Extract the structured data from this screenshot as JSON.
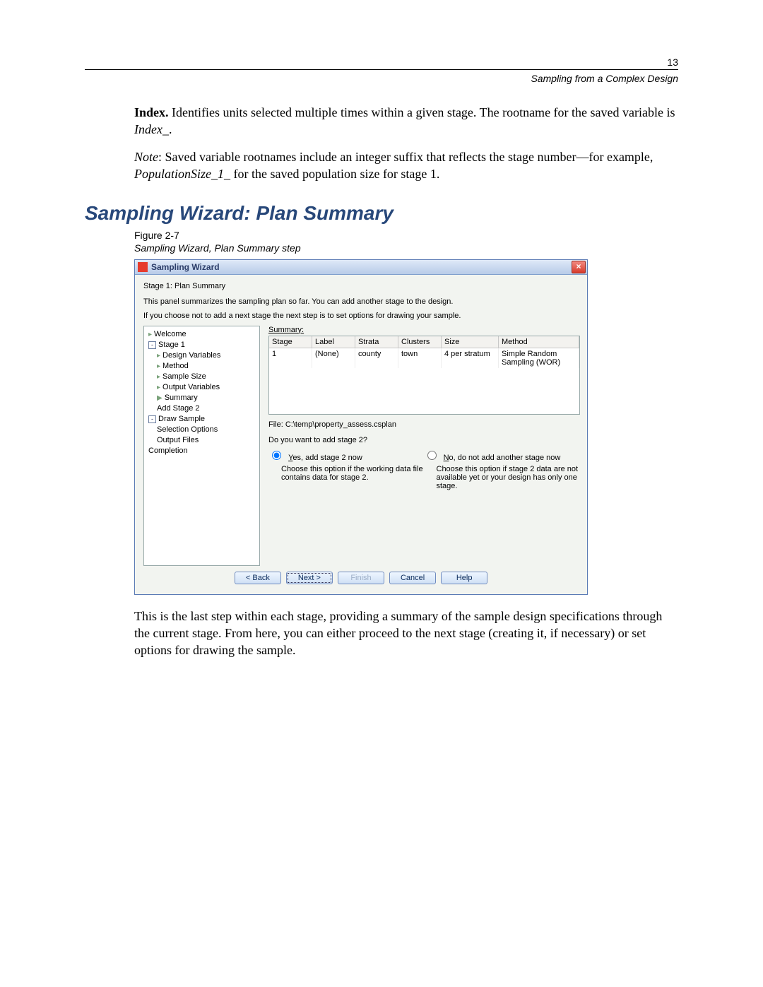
{
  "page": {
    "number": "13"
  },
  "running_head": "Sampling from a Complex Design",
  "para_index": {
    "lead": "Index.",
    "rest": " Identifies units selected multiple times within a given stage. The rootname for the saved variable is ",
    "ital": "Index_",
    "tail": "."
  },
  "para_note": {
    "lead": "Note",
    "mid": ": Saved variable rootnames include an integer suffix that reflects the stage number—for example, ",
    "ital": "PopulationSize_1_",
    "tail": " for the saved population size for stage 1."
  },
  "heading": "Sampling Wizard: Plan Summary",
  "figure": {
    "label": "Figure 2-7",
    "title": "Sampling Wizard, Plan Summary step"
  },
  "wizard": {
    "title": "Sampling Wizard",
    "stage_title": "Stage 1: Plan Summary",
    "line1": "This panel summarizes the sampling plan so far. You can add another stage to the design.",
    "line2": "If you choose not to add a next stage the next step is to set options for drawing your sample.",
    "tree": {
      "welcome": "Welcome",
      "stage1": "Stage 1",
      "design_vars": "Design Variables",
      "method": "Method",
      "sample_size": "Sample Size",
      "output_vars": "Output Variables",
      "summary": "Summary",
      "add_stage2": "Add Stage 2",
      "draw_sample": "Draw Sample",
      "sel_options": "Selection Options",
      "output_files": "Output Files",
      "completion": "Completion"
    },
    "summary": {
      "label": "Summary:",
      "headers": {
        "stage": "Stage",
        "label": "Label",
        "strata": "Strata",
        "clusters": "Clusters",
        "size": "Size",
        "method": "Method"
      },
      "row": {
        "stage": "1",
        "label": "(None)",
        "strata": "county",
        "clusters": "town",
        "size": "4 per stratum",
        "method": "Simple Random Sampling (WOR)"
      }
    },
    "file_label": "File:  C:\\temp\\property_assess.csplan",
    "question": "Do you want to add stage 2?",
    "opt_yes": {
      "pre": "Y",
      "post": "es, add stage 2 now",
      "expl": "Choose this option if the working data file contains data for stage 2."
    },
    "opt_no": {
      "pre": "N",
      "post": "o, do not add another stage now",
      "expl": "Choose this option if stage 2 data are not available yet or your design has only one stage."
    },
    "buttons": {
      "back": "< Back",
      "next": "Next >",
      "finish": "Finish",
      "cancel": "Cancel",
      "help": "Help"
    }
  },
  "followup": "This is the last step within each stage, providing a summary of the sample design specifications through the current stage. From here, you can either proceed to the next stage (creating it, if necessary) or set options for drawing the sample."
}
